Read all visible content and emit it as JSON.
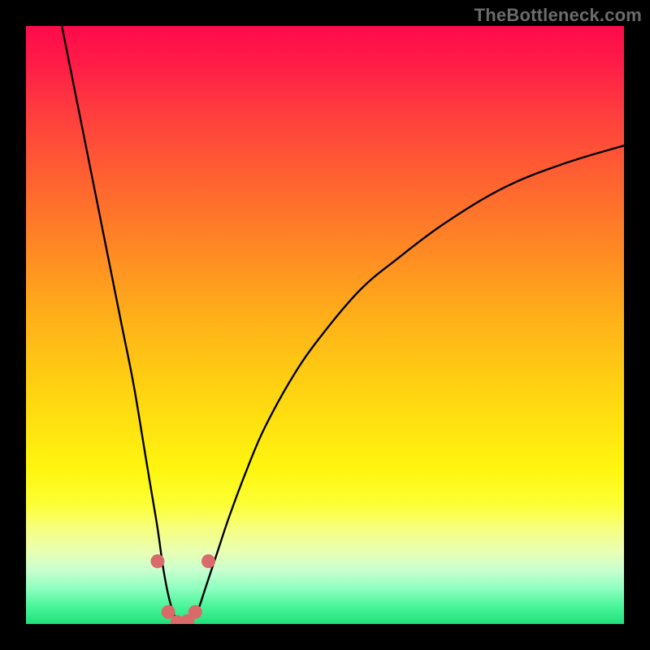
{
  "watermark": "TheBottleneck.com",
  "chart_data": {
    "type": "line",
    "title": "",
    "xlabel": "",
    "ylabel": "",
    "xlim": [
      0,
      100
    ],
    "ylim": [
      0,
      100
    ],
    "grid": false,
    "legend": false,
    "series": [
      {
        "name": "curve",
        "x": [
          6,
          8,
          10,
          12,
          14,
          16,
          18,
          20,
          21,
          22,
          23,
          24,
          25,
          26,
          27,
          28,
          29,
          30,
          32,
          34,
          37,
          40,
          45,
          50,
          56,
          62,
          70,
          80,
          90,
          100
        ],
        "y": [
          100,
          90,
          80,
          70,
          60,
          50,
          40,
          28,
          22,
          16,
          9,
          4,
          1,
          0,
          0,
          1,
          3,
          6,
          12,
          18,
          26,
          33,
          42,
          49,
          56,
          61,
          67,
          73,
          77,
          80
        ]
      }
    ],
    "markers": [
      {
        "x": 22.0,
        "y": 10.5
      },
      {
        "x": 23.8,
        "y": 2.0
      },
      {
        "x": 25.3,
        "y": 0.3
      },
      {
        "x": 27.0,
        "y": 0.5
      },
      {
        "x": 28.3,
        "y": 2.0
      },
      {
        "x": 30.5,
        "y": 10.5
      }
    ],
    "gradient_stops": [
      {
        "pos": 0.0,
        "color": "#ff0a4a"
      },
      {
        "pos": 0.06,
        "color": "#ff1b47"
      },
      {
        "pos": 0.14,
        "color": "#ff3b3f"
      },
      {
        "pos": 0.26,
        "color": "#ff6330"
      },
      {
        "pos": 0.38,
        "color": "#ff8b23"
      },
      {
        "pos": 0.5,
        "color": "#ffb418"
      },
      {
        "pos": 0.62,
        "color": "#ffd611"
      },
      {
        "pos": 0.74,
        "color": "#fff50f"
      },
      {
        "pos": 0.8,
        "color": "#fdff35"
      },
      {
        "pos": 0.84,
        "color": "#f6ff7f"
      },
      {
        "pos": 0.88,
        "color": "#e8ffb5"
      },
      {
        "pos": 0.91,
        "color": "#c8ffcf"
      },
      {
        "pos": 0.94,
        "color": "#8effc0"
      },
      {
        "pos": 0.97,
        "color": "#4bf59a"
      },
      {
        "pos": 1.0,
        "color": "#1fe07a"
      }
    ],
    "marker_color": "#d86a6a",
    "curve_color": "#000000"
  }
}
